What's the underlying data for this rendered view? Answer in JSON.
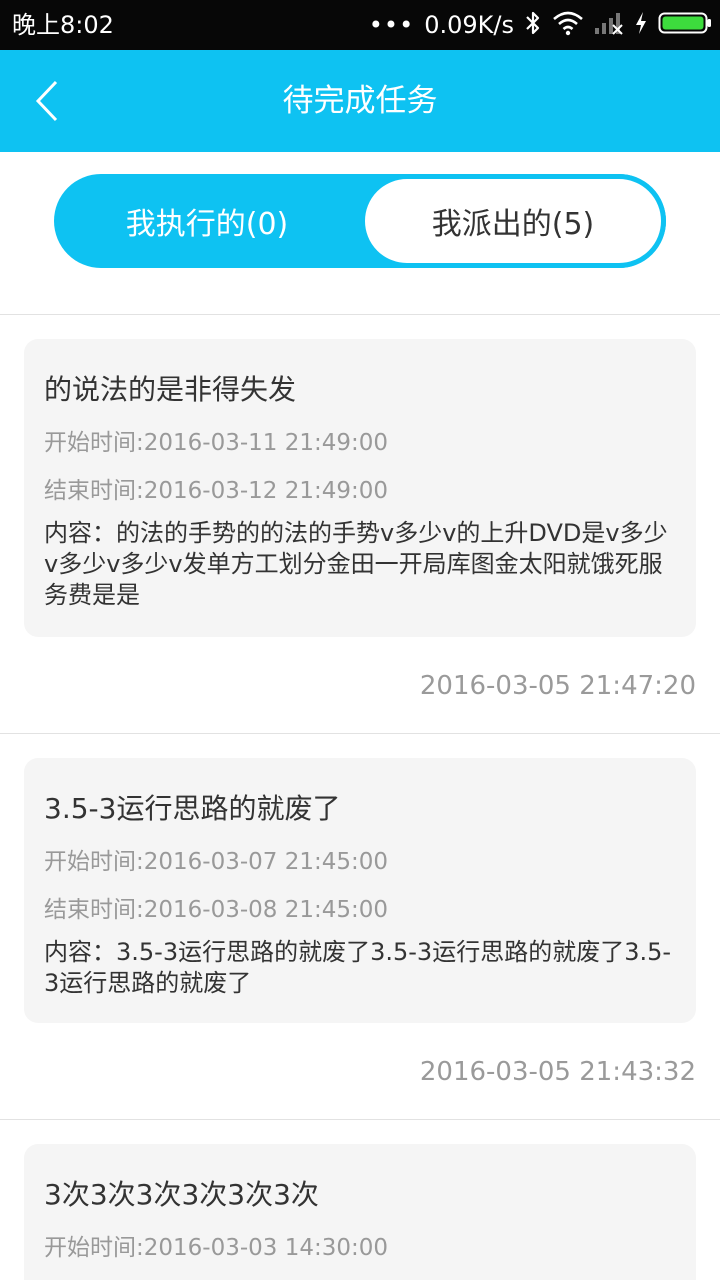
{
  "status_bar": {
    "time": "晚上8:02",
    "dots": "•••",
    "net_speed": "0.09K/s",
    "icons": [
      "bluetooth-icon",
      "wifi-icon",
      "signal-icon",
      "charging-icon",
      "battery-icon"
    ],
    "battery_color": "#3ddc3d"
  },
  "header": {
    "title": "待完成任务",
    "back_icon": "chevron-left-icon",
    "background_color": "#0ec2f2"
  },
  "tabs": [
    {
      "label": "我执行的(0)",
      "selected": false
    },
    {
      "label": "我派出的(5)",
      "selected": true
    }
  ],
  "tasks": [
    {
      "title": "的说法的是非得失发",
      "start": "开始时间:2016-03-11 21:49:00",
      "end": "结束时间:2016-03-12 21:49:00",
      "content": "内容：的法的手势的的法的手势v多少v的上升DVD是v多少v多少v多少v发单方工划分金田一开局库图金太阳就饿死服务费是是",
      "posted": "2016-03-05 21:47:20"
    },
    {
      "title": "3.5-3运行思路的就废了",
      "start": "开始时间:2016-03-07 21:45:00",
      "end": "结束时间:2016-03-08 21:45:00",
      "content": "内容：3.5-3运行思路的就废了3.5-3运行思路的就废了3.5-3运行思路的就废了",
      "posted": "2016-03-05 21:43:32"
    },
    {
      "title": "3次3次3次3次3次3次",
      "start": "开始时间:2016-03-03 14:30:00"
    }
  ]
}
